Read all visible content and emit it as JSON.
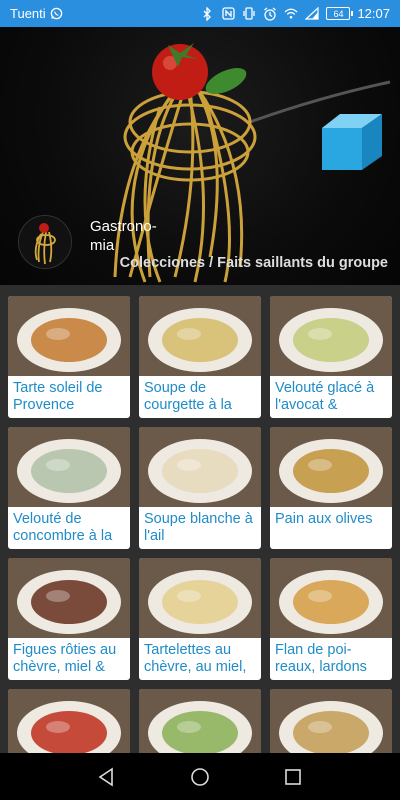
{
  "status_bar": {
    "carrier": "Tuenti",
    "battery": "64",
    "time": "12:07",
    "icons": [
      "whatsapp-icon",
      "bluetooth-icon",
      "nfc-icon",
      "vibrate-icon",
      "alarm-icon",
      "wifi-icon",
      "signal-icon",
      "battery-icon"
    ]
  },
  "header": {
    "app_name": "Gastrono-\nmia",
    "breadcrumb": "Colecciones / Faits saillants du groupe",
    "hero_icon": "cube-icon"
  },
  "recipes": [
    {
      "title": "Tarte soleil de Provence",
      "color": "#c98a4a"
    },
    {
      "title": "Soupe de courgette à la",
      "color": "#d9c27a"
    },
    {
      "title": "Velouté glacé à l'avocat &",
      "color": "#c9d08a"
    },
    {
      "title": "Velouté de concombre à la",
      "color": "#b9c7b0"
    },
    {
      "title": "Soupe blanche à l'ail",
      "color": "#e8dcc0"
    },
    {
      "title": "Pain aux olives",
      "color": "#c8a052"
    },
    {
      "title": "Figues rôties au chèvre, miel &",
      "color": "#7a4b3b"
    },
    {
      "title": "Tartelettes au chèvre, au miel,",
      "color": "#e6d39a"
    },
    {
      "title": "Flan de poi-reaux, lardons",
      "color": "#d9a85a"
    },
    {
      "title": "",
      "color": "#c64a3a"
    },
    {
      "title": "",
      "color": "#98b86a"
    },
    {
      "title": "",
      "color": "#caa86a"
    }
  ],
  "nav": {
    "back": "back-icon",
    "home": "home-icon",
    "recents": "recents-icon"
  },
  "colors": {
    "status_bar": "#2b8fe0",
    "title_link": "#1f8cc7",
    "grid_bg": "#2e2e2e"
  }
}
